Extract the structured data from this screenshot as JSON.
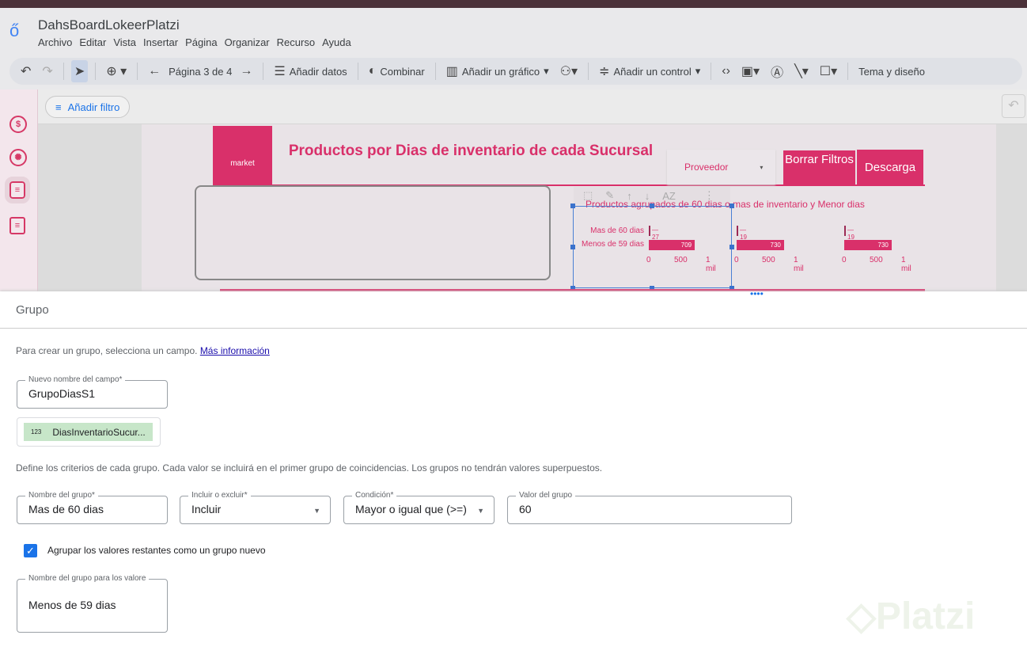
{
  "app": {
    "title": "DahsBoardLokeerPlatzi",
    "menu": [
      "Archivo",
      "Editar",
      "Vista",
      "Insertar",
      "Página",
      "Organizar",
      "Recurso",
      "Ayuda"
    ]
  },
  "toolbar": {
    "page_label": "Página 3 de 4",
    "add_data": "Añadir datos",
    "blend": "Combinar",
    "add_chart": "Añadir un gráfico",
    "add_control": "Añadir un control",
    "theme": "Tema y diseño"
  },
  "filterbar": {
    "add_filter": "Añadir filtro"
  },
  "report": {
    "logo_text": "market",
    "title": "Productos por Dias de inventario de cada Sucursal",
    "provider": "Proveedor",
    "clear_filters": "Borrar Filtros",
    "download": "Descarga",
    "chart_title": "Productos agrupados de 60 dias o mas de inventario  y Menor dias"
  },
  "chart_data": [
    {
      "type": "bar",
      "categories": [
        "Mas de 60 dias",
        "Menos de 59 dias"
      ],
      "values": [
        27,
        709
      ],
      "xticks": [
        "0",
        "500",
        "1 mil"
      ],
      "xlim": [
        0,
        1000
      ]
    },
    {
      "type": "bar",
      "categories": [
        "Mas de 60 dias",
        "Menos de 59 dias"
      ],
      "values": [
        19,
        730
      ],
      "xticks": [
        "0",
        "500",
        "1 mil"
      ],
      "xlim": [
        0,
        1000
      ]
    },
    {
      "type": "bar",
      "categories": [
        "Mas de 60 dias",
        "Menos de 59 dias"
      ],
      "values": [
        19,
        730
      ],
      "xticks": [
        "0",
        "500",
        "1 mil"
      ],
      "xlim": [
        0,
        1000
      ]
    }
  ],
  "panel": {
    "title": "Grupo",
    "intro": "Para crear un grupo, selecciona un campo.",
    "more_info": "Más información",
    "new_field_label": "Nuevo nombre del campo*",
    "new_field_value": "GrupoDiasS1",
    "field_chip_type": "123",
    "field_chip": "DiasInventarioSucur...",
    "criteria": "Define los criterios de cada grupo. Cada valor se incluirá en el primer grupo de coincidencias. Los grupos no tendrán valores superpuestos.",
    "group_name_label": "Nombre del grupo*",
    "group_name": "Mas de 60 dias",
    "include_label": "Incluir o excluir*",
    "include": "Incluir",
    "condition_label": "Condición*",
    "condition": "Mayor o igual que (>=)",
    "value_label": "Valor del grupo",
    "value": "60",
    "remaining_checkbox": "Agrupar los valores restantes como un grupo nuevo",
    "remaining_label": "Nombre del grupo para los valore",
    "remaining_value": "Menos de 59 dias"
  },
  "watermark": "Platzi"
}
